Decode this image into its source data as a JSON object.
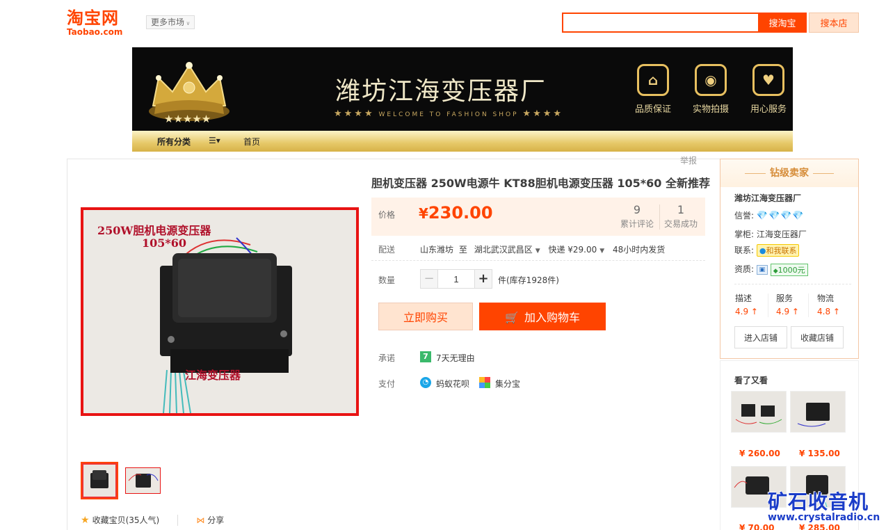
{
  "header": {
    "logo_cn": "淘宝网",
    "logo_en": "Taobao.com",
    "more_market": "更多市场",
    "search_value": "",
    "search_taobao": "搜淘宝",
    "search_shop": "搜本店"
  },
  "banner": {
    "shop_name": "潍坊江海变压器厂",
    "welcome": "WELCOME TO FASHION SHOP",
    "stars": "★★★★",
    "badges": [
      {
        "label": "品质保证",
        "icon": "tag-icon"
      },
      {
        "label": "实物拍摄",
        "icon": "camera-icon"
      },
      {
        "label": "用心服务",
        "icon": "heart-icon"
      }
    ],
    "nav": {
      "all_categories": "所有分类",
      "menu_icon": "☰▾",
      "home": "首页"
    }
  },
  "product": {
    "report": "举报",
    "title": "胆机变压器 250W电源牛 KT88胆机电源变压器 105*60 全新推荐",
    "image_caption_1": "250W胆机电源变压器",
    "image_caption_2": "105*60",
    "image_caption_3": "江海变压器",
    "price_label": "价格",
    "currency": "¥",
    "price": "230.00",
    "reviews_count": "9",
    "reviews_label": "累计评论",
    "sales_count": "1",
    "sales_label": "交易成功",
    "ship_label": "配送",
    "ship_from": "山东潍坊",
    "ship_to_word": "至",
    "ship_to": "湖北武汉武昌区",
    "ship_method": "快递 ¥29.00",
    "ship_time": "48小时内发货",
    "qty_label": "数量",
    "qty_value": "1",
    "qty_minus": "−",
    "qty_plus": "+",
    "stock": "件(库存1928件)",
    "buy_now": "立即购买",
    "add_cart": "加入购物车",
    "promise_label": "承诺",
    "promise_icon_text": "7",
    "promise": "7天无理由",
    "pay_label": "支付",
    "pay_1": "蚂蚁花呗",
    "pay_2": "集分宝",
    "favorite": "收藏宝贝",
    "favorite_count": "(35人气)",
    "share": "分享"
  },
  "seller": {
    "level": "钻级卖家",
    "shop_name": "潍坊江海变压器厂",
    "credit_label": "信誉:",
    "credit_diamonds": "💎💎💎💎",
    "keeper_label": "掌柜:",
    "keeper": "江海变压器厂",
    "contact_label": "联系:",
    "contact_btn": "和我联系",
    "qual_label": "资质:",
    "deposit": "1000",
    "deposit_unit": "元",
    "scores": [
      {
        "name": "描述",
        "value": "4.9 ↑"
      },
      {
        "name": "服务",
        "value": "4.9 ↑"
      },
      {
        "name": "物流",
        "value": "4.8 ↑"
      }
    ],
    "enter_shop": "进入店铺",
    "fav_shop": "收藏店铺"
  },
  "also_viewed": {
    "title": "看了又看",
    "items": [
      {
        "price": "¥ 260.00"
      },
      {
        "price": "¥ 135.00"
      },
      {
        "price": "¥ 70.00"
      },
      {
        "price": "¥ 285.00"
      }
    ]
  },
  "watermark": {
    "line1": "矿石收音机",
    "line2": "www.crystalradio.cn"
  },
  "colors": {
    "accent": "#ff4400",
    "banner_bg": "#0a0a0a",
    "gold": "#d7b248"
  }
}
